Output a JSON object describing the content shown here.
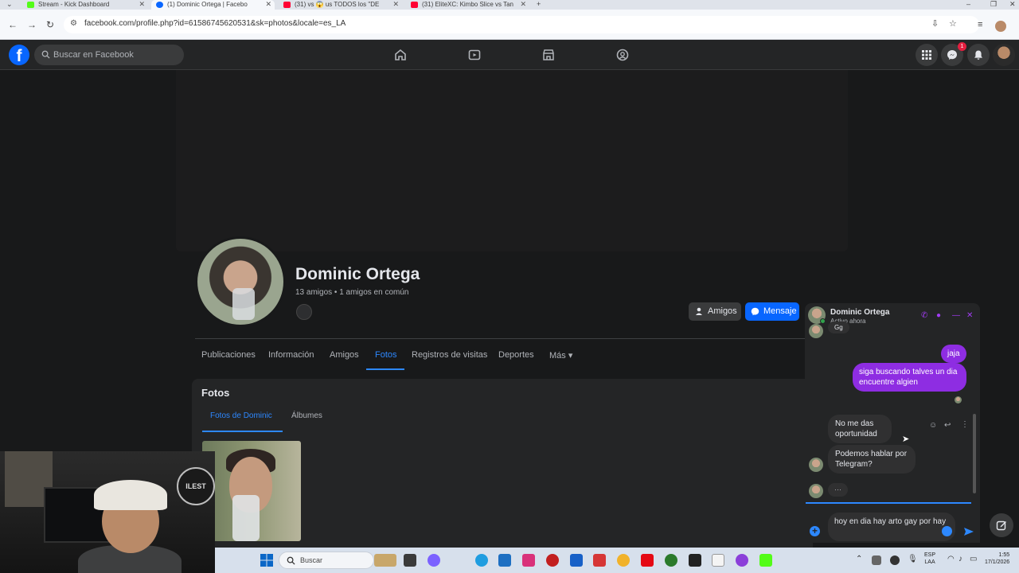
{
  "browser": {
    "tabs": [
      {
        "title": "Stream - Kick Dashboard",
        "favicon_color": "#53fc18"
      },
      {
        "title": "(1) Dominic Ortega | Facebo",
        "favicon_color": "#0866ff"
      },
      {
        "title": "(31) vs 😱 us TODOS los \"DE",
        "favicon_color": "#ff0033"
      },
      {
        "title": "(31) EliteXC: Kimbo Slice vs Tan",
        "favicon_color": "#ff0033"
      }
    ],
    "url": "facebook.com/profile.php?id=61586745620531&sk=photos&locale=es_LA"
  },
  "facebook": {
    "logo": "f",
    "search_placeholder": "Buscar en Facebook",
    "messenger_badge": "1",
    "profile": {
      "name": "Dominic Ortega",
      "friends_line": "13 amigos • 1 amigos en común",
      "friends_button": "Amigos",
      "message_button": "Mensaje"
    },
    "tabs": [
      {
        "label": "Publicaciones"
      },
      {
        "label": "Información"
      },
      {
        "label": "Amigos"
      },
      {
        "label": "Fotos"
      },
      {
        "label": "Registros de visitas"
      },
      {
        "label": "Deportes"
      },
      {
        "label": "Más ▾"
      }
    ],
    "photos": {
      "title": "Fotos",
      "subtabs": [
        "Fotos de Dominic",
        "Álbumes"
      ]
    },
    "accent_color": "#2d88ff",
    "chat": {
      "name": "Dominic Ortega",
      "status": "Activo ahora",
      "messages": [
        {
          "from": "them",
          "text": "Gg"
        },
        {
          "from": "me",
          "text": "jaja"
        },
        {
          "from": "me",
          "text": "siga buscando talves un dia encuentre algien"
        },
        {
          "from": "them",
          "text": "No me das oportunidad"
        },
        {
          "from": "them",
          "text": "Podemos hablar por Telegram?"
        },
        {
          "from": "them",
          "text": "···"
        }
      ],
      "draft": "hoy en dia hay arto gay por hay",
      "bubble_color": "#8e2de2"
    }
  },
  "webcam": {
    "logo_text": "ILEST"
  },
  "taskbar": {
    "search": "Buscar",
    "lang_line1": "ESP",
    "lang_line2": "LAA",
    "time": "1:55",
    "date": "17/1/2026"
  }
}
